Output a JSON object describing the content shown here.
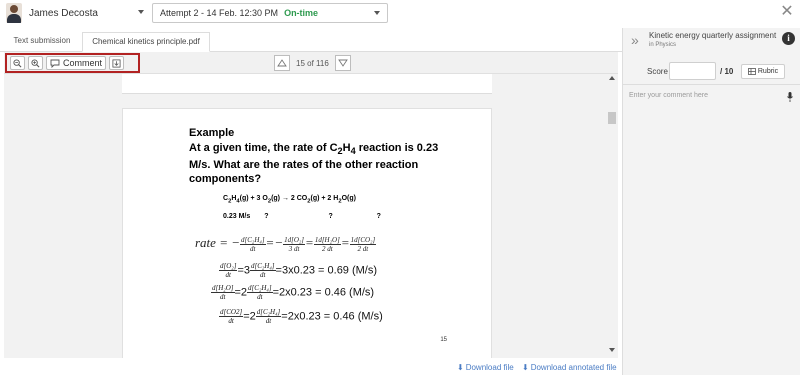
{
  "header": {
    "student_name": "James Decosta",
    "attempt_label": "Attempt 2 - 14 Feb. 12:30 PM",
    "attempt_status": "On-time",
    "status_color": "#2e9a4f",
    "close_icon": "close-icon"
  },
  "tabs": [
    {
      "label": "Text submission"
    },
    {
      "label": "Chemical kinetics principle.pdf",
      "active": true
    }
  ],
  "toolbar": {
    "zoom_out_icon": "zoom-out-icon",
    "zoom_in_icon": "zoom-in-icon",
    "comment_label": "Comment",
    "download_icon": "download-icon",
    "page_info": "15 of 116"
  },
  "document": {
    "title": "Example",
    "question_html": "At a given time, the rate of C<sub>2</sub>H<sub>4</sub> reaction is 0.23 M/s.  What are the rates of the other reaction components?",
    "equation_html": "C<sub>2</sub>H<sub>4</sub>(g) + 3 O<sub>2</sub>(g) → 2 CO<sub>2</sub>(g)  +  2 H<sub>2</sub>O(g)",
    "rates_row": [
      "0.23 M/s",
      "?",
      "?",
      "?"
    ],
    "rate_word": "rate",
    "result1": "=3x0.23 = 0.69 (M/s)",
    "result2": "=2x0.23 = 0.46 (M/s)",
    "result3": "=2x0.23 = 0.46 (M/s)",
    "page_number": "15"
  },
  "downloads": {
    "download_file": "Download file",
    "download_annotated": "Download annotated file"
  },
  "panel": {
    "assignment_title": "Kinetic energy quarterly assignment",
    "assignment_sub": "in Physics",
    "score_label": "Score",
    "score_value": "",
    "score_max": "/ 10",
    "rubric_label": "Rubric",
    "comment_placeholder": "Enter your comment here"
  }
}
